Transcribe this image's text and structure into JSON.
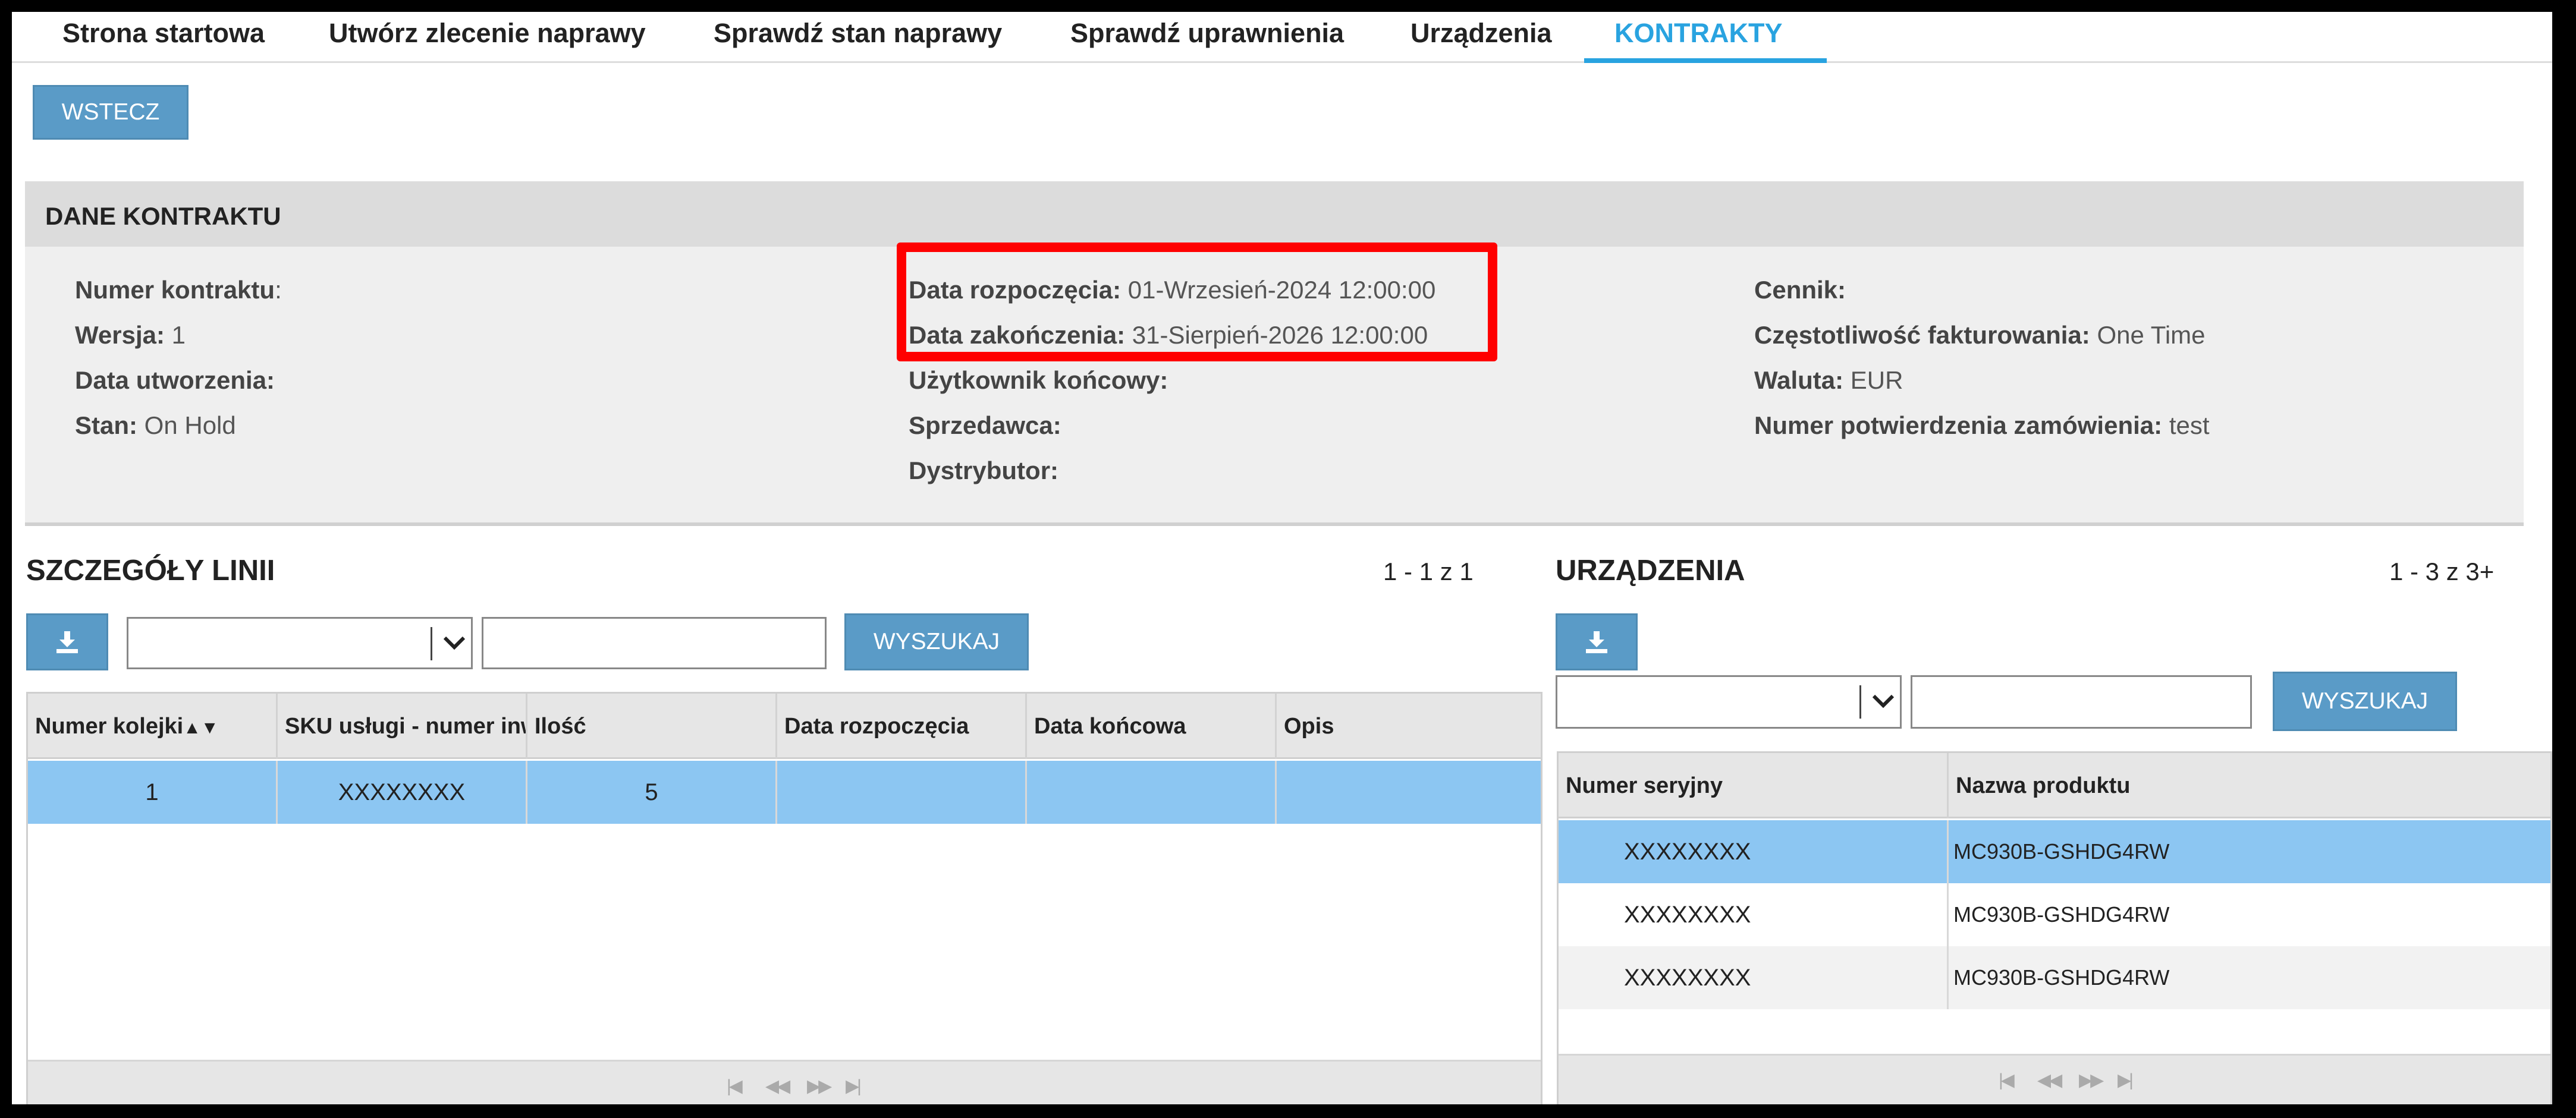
{
  "nav": {
    "items": [
      "Strona startowa",
      "Utwórz zlecenie naprawy",
      "Sprawdź stan naprawy",
      "Sprawdź uprawnienia",
      "Urządzenia",
      "KONTRAKTY"
    ],
    "active_index": 5
  },
  "back_button": "WSTECZ",
  "contract": {
    "title": "DANE KONTRAKTU",
    "fields": {
      "contract_number": {
        "label": "Numer kontraktu",
        "value": ""
      },
      "version": {
        "label": "Wersja:",
        "value": "1"
      },
      "created_date": {
        "label": "Data utworzenia:",
        "value": ""
      },
      "state": {
        "label": "Stan:",
        "value": "On Hold"
      },
      "start_date": {
        "label": "Data rozpoczęcia:",
        "value": "01-Wrzesień-2024 12:00:00"
      },
      "end_date": {
        "label": "Data zakończenia:",
        "value": "31-Sierpień-2026 12:00:00"
      },
      "end_user": {
        "label": "Użytkownik końcowy:",
        "value": ""
      },
      "seller": {
        "label": "Sprzedawca:",
        "value": ""
      },
      "distributor": {
        "label": "Dystrybutor:",
        "value": ""
      },
      "price_list": {
        "label": "Cennik:",
        "value": ""
      },
      "billing_frequency": {
        "label": "Częstotliwość fakturowania:",
        "value": "One Time"
      },
      "currency": {
        "label": "Waluta:",
        "value": "EUR"
      },
      "order_confirmation": {
        "label": "Numer potwierdzenia zamówienia:",
        "value": "test"
      }
    },
    "highlight_color": "#ff0000"
  },
  "lines": {
    "title": "SZCZEGÓŁY LINII",
    "pager": "1 - 1 z 1",
    "search_button": "WYSZUKAJ",
    "columns": [
      "Numer kolejki",
      "SKU usługi - numer inw",
      "Ilość",
      "Data rozpoczęcia",
      "Data końcowa",
      "Opis"
    ],
    "rows": [
      {
        "seq": "1",
        "sku": "XXXXXXXX",
        "qty": "5",
        "start": "",
        "end": "",
        "desc": ""
      }
    ]
  },
  "devices": {
    "title": "URZĄDZENIA",
    "pager": "1 - 3 z 3+",
    "search_button": "WYSZUKAJ",
    "columns": [
      "Numer seryjny",
      "Nazwa produktu"
    ],
    "rows": [
      {
        "serial": "XXXXXXXX",
        "product": "MC930B-GSHDG4RW"
      },
      {
        "serial": "XXXXXXXX",
        "product": "MC930B-GSHDG4RW"
      },
      {
        "serial": "XXXXXXXX",
        "product": "MC930B-GSHDG4RW"
      }
    ]
  },
  "colors": {
    "accent": "#29a3e0",
    "button": "#5a9bc7",
    "selected_row": "#8cc6f2"
  }
}
